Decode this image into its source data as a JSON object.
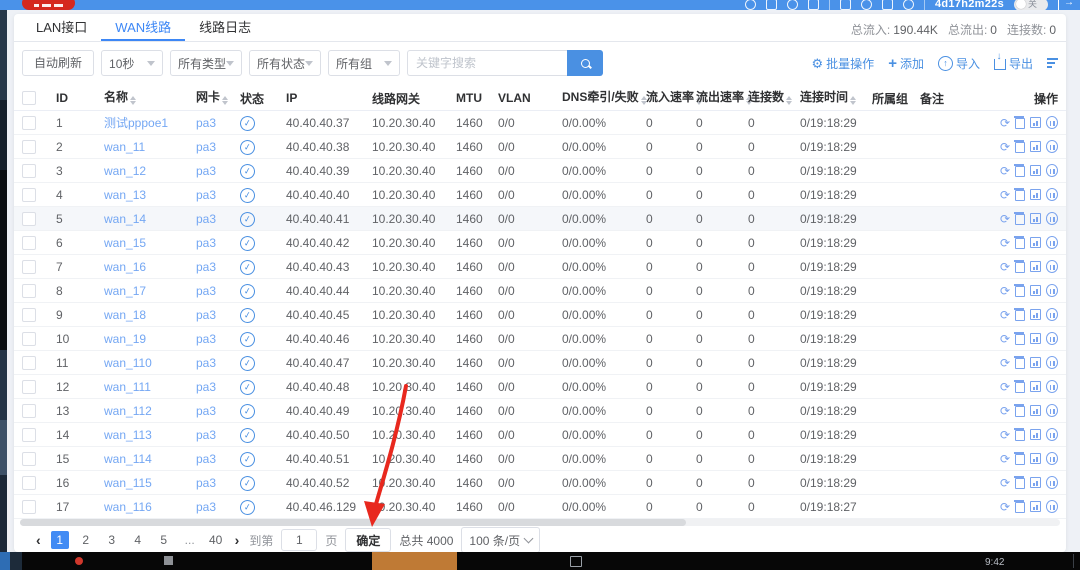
{
  "topbar": {
    "session": "4d17h2m22s",
    "toggle": "关"
  },
  "tabs": [
    {
      "label": "LAN接口",
      "active": false
    },
    {
      "label": "WAN线路",
      "active": true
    },
    {
      "label": "线路日志",
      "active": false
    }
  ],
  "stats": {
    "items": [
      {
        "label": "总流入:",
        "value": "190.44K"
      },
      {
        "label": "总流出:",
        "value": "0"
      },
      {
        "label": "连接数:",
        "value": "0"
      }
    ]
  },
  "filters": {
    "auto_refresh": "自动刷新",
    "selects": [
      {
        "value": "10秒"
      },
      {
        "value": "所有类型"
      },
      {
        "value": "所有状态"
      },
      {
        "value": "所有组"
      }
    ],
    "search_placeholder": "关键字搜索"
  },
  "toolbar": {
    "batch": "批量操作",
    "add": "添加",
    "import": "导入",
    "export": "导出"
  },
  "table": {
    "headers": [
      {
        "label": "ID",
        "sortable": false
      },
      {
        "label": "名称",
        "sortable": true
      },
      {
        "label": "网卡",
        "sortable": true
      },
      {
        "label": "状态",
        "sortable": false
      },
      {
        "label": "IP",
        "sortable": false
      },
      {
        "label": "线路网关",
        "sortable": false
      },
      {
        "label": "MTU",
        "sortable": false
      },
      {
        "label": "VLAN",
        "sortable": false
      },
      {
        "label": "DNS牵引/失败",
        "sortable": true
      },
      {
        "label": "流入速率",
        "sortable": true
      },
      {
        "label": "流出速率",
        "sortable": true
      },
      {
        "label": "连接数",
        "sortable": true
      },
      {
        "label": "连接时间",
        "sortable": true
      },
      {
        "label": "所属组",
        "sortable": false
      },
      {
        "label": "备注",
        "sortable": false
      },
      {
        "label": "操作",
        "sortable": false
      }
    ],
    "rows": [
      {
        "id": "1",
        "name": "测试pppoe1",
        "nic": "pa3",
        "status": "ok",
        "ip": "40.40.40.37",
        "gateway": "10.20.30.40",
        "mtu": "1460",
        "vlan": "0/0",
        "dns": "0/0.00%",
        "rate_in": "0",
        "rate_out": "0",
        "connections": "0",
        "time": "0/19:18:29",
        "group": "",
        "note": "",
        "highlight": false
      },
      {
        "id": "2",
        "name": "wan_11",
        "nic": "pa3",
        "status": "ok",
        "ip": "40.40.40.38",
        "gateway": "10.20.30.40",
        "mtu": "1460",
        "vlan": "0/0",
        "dns": "0/0.00%",
        "rate_in": "0",
        "rate_out": "0",
        "connections": "0",
        "time": "0/19:18:29",
        "group": "",
        "note": "",
        "highlight": false
      },
      {
        "id": "3",
        "name": "wan_12",
        "nic": "pa3",
        "status": "ok",
        "ip": "40.40.40.39",
        "gateway": "10.20.30.40",
        "mtu": "1460",
        "vlan": "0/0",
        "dns": "0/0.00%",
        "rate_in": "0",
        "rate_out": "0",
        "connections": "0",
        "time": "0/19:18:29",
        "group": "",
        "note": "",
        "highlight": false
      },
      {
        "id": "4",
        "name": "wan_13",
        "nic": "pa3",
        "status": "ok",
        "ip": "40.40.40.40",
        "gateway": "10.20.30.40",
        "mtu": "1460",
        "vlan": "0/0",
        "dns": "0/0.00%",
        "rate_in": "0",
        "rate_out": "0",
        "connections": "0",
        "time": "0/19:18:29",
        "group": "",
        "note": "",
        "highlight": false
      },
      {
        "id": "5",
        "name": "wan_14",
        "nic": "pa3",
        "status": "ok",
        "ip": "40.40.40.41",
        "gateway": "10.20.30.40",
        "mtu": "1460",
        "vlan": "0/0",
        "dns": "0/0.00%",
        "rate_in": "0",
        "rate_out": "0",
        "connections": "0",
        "time": "0/19:18:29",
        "group": "",
        "note": "",
        "highlight": true
      },
      {
        "id": "6",
        "name": "wan_15",
        "nic": "pa3",
        "status": "ok",
        "ip": "40.40.40.42",
        "gateway": "10.20.30.40",
        "mtu": "1460",
        "vlan": "0/0",
        "dns": "0/0.00%",
        "rate_in": "0",
        "rate_out": "0",
        "connections": "0",
        "time": "0/19:18:29",
        "group": "",
        "note": "",
        "highlight": false
      },
      {
        "id": "7",
        "name": "wan_16",
        "nic": "pa3",
        "status": "ok",
        "ip": "40.40.40.43",
        "gateway": "10.20.30.40",
        "mtu": "1460",
        "vlan": "0/0",
        "dns": "0/0.00%",
        "rate_in": "0",
        "rate_out": "0",
        "connections": "0",
        "time": "0/19:18:29",
        "group": "",
        "note": "",
        "highlight": false
      },
      {
        "id": "8",
        "name": "wan_17",
        "nic": "pa3",
        "status": "ok",
        "ip": "40.40.40.44",
        "gateway": "10.20.30.40",
        "mtu": "1460",
        "vlan": "0/0",
        "dns": "0/0.00%",
        "rate_in": "0",
        "rate_out": "0",
        "connections": "0",
        "time": "0/19:18:29",
        "group": "",
        "note": "",
        "highlight": false
      },
      {
        "id": "9",
        "name": "wan_18",
        "nic": "pa3",
        "status": "ok",
        "ip": "40.40.40.45",
        "gateway": "10.20.30.40",
        "mtu": "1460",
        "vlan": "0/0",
        "dns": "0/0.00%",
        "rate_in": "0",
        "rate_out": "0",
        "connections": "0",
        "time": "0/19:18:29",
        "group": "",
        "note": "",
        "highlight": false
      },
      {
        "id": "10",
        "name": "wan_19",
        "nic": "pa3",
        "status": "ok",
        "ip": "40.40.40.46",
        "gateway": "10.20.30.40",
        "mtu": "1460",
        "vlan": "0/0",
        "dns": "0/0.00%",
        "rate_in": "0",
        "rate_out": "0",
        "connections": "0",
        "time": "0/19:18:29",
        "group": "",
        "note": "",
        "highlight": false
      },
      {
        "id": "11",
        "name": "wan_110",
        "nic": "pa3",
        "status": "ok",
        "ip": "40.40.40.47",
        "gateway": "10.20.30.40",
        "mtu": "1460",
        "vlan": "0/0",
        "dns": "0/0.00%",
        "rate_in": "0",
        "rate_out": "0",
        "connections": "0",
        "time": "0/19:18:29",
        "group": "",
        "note": "",
        "highlight": false
      },
      {
        "id": "12",
        "name": "wan_111",
        "nic": "pa3",
        "status": "ok",
        "ip": "40.40.40.48",
        "gateway": "10.20.30.40",
        "mtu": "1460",
        "vlan": "0/0",
        "dns": "0/0.00%",
        "rate_in": "0",
        "rate_out": "0",
        "connections": "0",
        "time": "0/19:18:29",
        "group": "",
        "note": "",
        "highlight": false
      },
      {
        "id": "13",
        "name": "wan_112",
        "nic": "pa3",
        "status": "ok",
        "ip": "40.40.40.49",
        "gateway": "10.20.30.40",
        "mtu": "1460",
        "vlan": "0/0",
        "dns": "0/0.00%",
        "rate_in": "0",
        "rate_out": "0",
        "connections": "0",
        "time": "0/19:18:29",
        "group": "",
        "note": "",
        "highlight": false
      },
      {
        "id": "14",
        "name": "wan_113",
        "nic": "pa3",
        "status": "ok",
        "ip": "40.40.40.50",
        "gateway": "10.20.30.40",
        "mtu": "1460",
        "vlan": "0/0",
        "dns": "0/0.00%",
        "rate_in": "0",
        "rate_out": "0",
        "connections": "0",
        "time": "0/19:18:29",
        "group": "",
        "note": "",
        "highlight": false
      },
      {
        "id": "15",
        "name": "wan_114",
        "nic": "pa3",
        "status": "ok",
        "ip": "40.40.40.51",
        "gateway": "10.20.30.40",
        "mtu": "1460",
        "vlan": "0/0",
        "dns": "0/0.00%",
        "rate_in": "0",
        "rate_out": "0",
        "connections": "0",
        "time": "0/19:18:29",
        "group": "",
        "note": "",
        "highlight": false
      },
      {
        "id": "16",
        "name": "wan_115",
        "nic": "pa3",
        "status": "ok",
        "ip": "40.40.40.52",
        "gateway": "10.20.30.40",
        "mtu": "1460",
        "vlan": "0/0",
        "dns": "0/0.00%",
        "rate_in": "0",
        "rate_out": "0",
        "connections": "0",
        "time": "0/19:18:29",
        "group": "",
        "note": "",
        "highlight": false
      },
      {
        "id": "17",
        "name": "wan_116",
        "nic": "pa3",
        "status": "ok",
        "ip": "40.40.46.129",
        "gateway": "10.20.30.40",
        "mtu": "1460",
        "vlan": "0/0",
        "dns": "0/0.00%",
        "rate_in": "0",
        "rate_out": "0",
        "connections": "0",
        "time": "0/19:18:27",
        "group": "",
        "note": "",
        "highlight": false
      }
    ]
  },
  "pagination": {
    "pages": [
      {
        "label": "1",
        "active": true
      },
      {
        "label": "2",
        "active": false
      },
      {
        "label": "3",
        "active": false
      },
      {
        "label": "4",
        "active": false
      },
      {
        "label": "5",
        "active": false
      },
      {
        "label": "...",
        "active": false
      },
      {
        "label": "40",
        "active": false
      }
    ],
    "goto_label": "到第",
    "goto_value": "1",
    "page_unit": "页",
    "confirm": "确定",
    "total": "总共 4000",
    "page_size": "100 条/页"
  },
  "annotation": {
    "shape": "red-arrow",
    "points_to": "total-count"
  },
  "taskbar": {
    "clock": "9:42"
  },
  "colors": {
    "accent": "#3d87f5",
    "topbar": "#4a92e9",
    "link": "#74a7f3",
    "arrow": "#e8281e",
    "badge": "#d5281e"
  }
}
